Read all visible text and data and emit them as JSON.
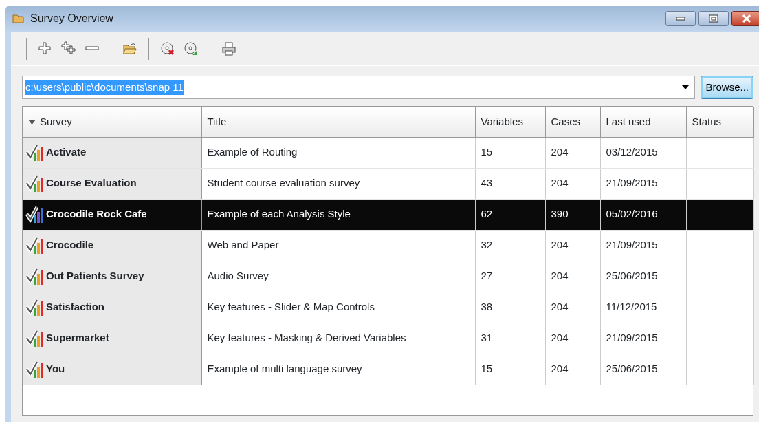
{
  "window": {
    "title": "Survey Overview"
  },
  "path": {
    "value": "c:\\users\\public\\documents\\snap 11",
    "selected": true
  },
  "browse_button": "Browse...",
  "table": {
    "columns": [
      {
        "label": "Survey",
        "sorted": true
      },
      {
        "label": "Title",
        "sorted": false
      },
      {
        "label": "Variables",
        "sorted": false
      },
      {
        "label": "Cases",
        "sorted": false
      },
      {
        "label": "Last used",
        "sorted": false
      },
      {
        "label": "Status",
        "sorted": false
      }
    ],
    "rows": [
      {
        "survey": "Activate",
        "title": "Example of Routing",
        "variables": "15",
        "cases": "204",
        "last_used": "03/12/2015",
        "selected": false
      },
      {
        "survey": "Course Evaluation",
        "title": "Student course evaluation survey",
        "variables": "43",
        "cases": "204",
        "last_used": "21/09/2015",
        "selected": false
      },
      {
        "survey": "Crocodile Rock Cafe",
        "title": "Example of each Analysis Style",
        "variables": "62",
        "cases": "390",
        "last_used": "05/02/2016",
        "selected": true
      },
      {
        "survey": "Crocodile",
        "title": "Web and Paper",
        "variables": "32",
        "cases": "204",
        "last_used": "21/09/2015",
        "selected": false
      },
      {
        "survey": "Out Patients Survey",
        "title": "Audio Survey",
        "variables": "27",
        "cases": "204",
        "last_used": "25/06/2015",
        "selected": false
      },
      {
        "survey": "Satisfaction",
        "title": "Key features - Slider & Map Controls",
        "variables": "38",
        "cases": "204",
        "last_used": "11/12/2015",
        "selected": false
      },
      {
        "survey": "Supermarket",
        "title": "Key features - Masking & Derived Variables",
        "variables": "31",
        "cases": "204",
        "last_used": "21/09/2015",
        "selected": false
      },
      {
        "survey": "You",
        "title": "Example of multi language survey",
        "variables": "15",
        "cases": "204",
        "last_used": "25/06/2015",
        "selected": false
      }
    ]
  }
}
